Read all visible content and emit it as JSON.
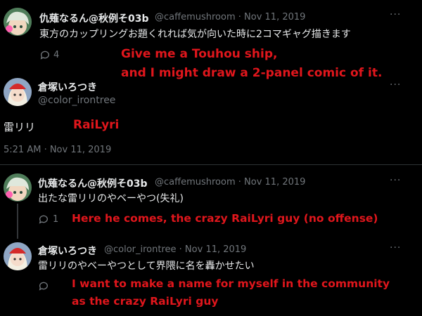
{
  "tweet1": {
    "name": "仇薙なるん@秋例そ03b",
    "handle": "@caffemushroom",
    "date": "· Nov 11, 2019",
    "text": "東方のカップリングお題くれれば気が向いた時に2コマギャグ描きます",
    "reply_count": "4",
    "translation_line1": "Give me a Touhou ship,",
    "translation_line2": "and I might draw a 2-panel comic of it."
  },
  "main_tweet": {
    "name": "倉塚いろつき",
    "handle": "@color_irontree",
    "text": "雷リリ",
    "translation": "RaiLyri",
    "timestamp": "5:21 AM · Nov 11, 2019"
  },
  "tweet3": {
    "name": "仇薙なるん@秋例そ03b",
    "handle": "@caffemushroom",
    "date": "· Nov 11, 2019",
    "text": "出たな雷リリのやベーやつ(失礼)",
    "reply_count": "1",
    "translation": "Here he comes, the crazy RaiLyri guy (no offense)"
  },
  "tweet4": {
    "name": "倉塚いろつき",
    "handle": "@color_irontree",
    "date": "· Nov 11, 2019",
    "text": "雷リリのやベーやつとして界隈に名を轟かせたい",
    "translation_line1": "I want to make a name for myself in the community",
    "translation_line2": "as the crazy RaiLyri guy"
  },
  "icons": {
    "more": "more-icon",
    "reply": "reply-icon"
  },
  "colors": {
    "background": "#000000",
    "text": "#e7e9ea",
    "muted": "#71767b",
    "translation": "#e0161c",
    "divider": "#2f3336"
  }
}
